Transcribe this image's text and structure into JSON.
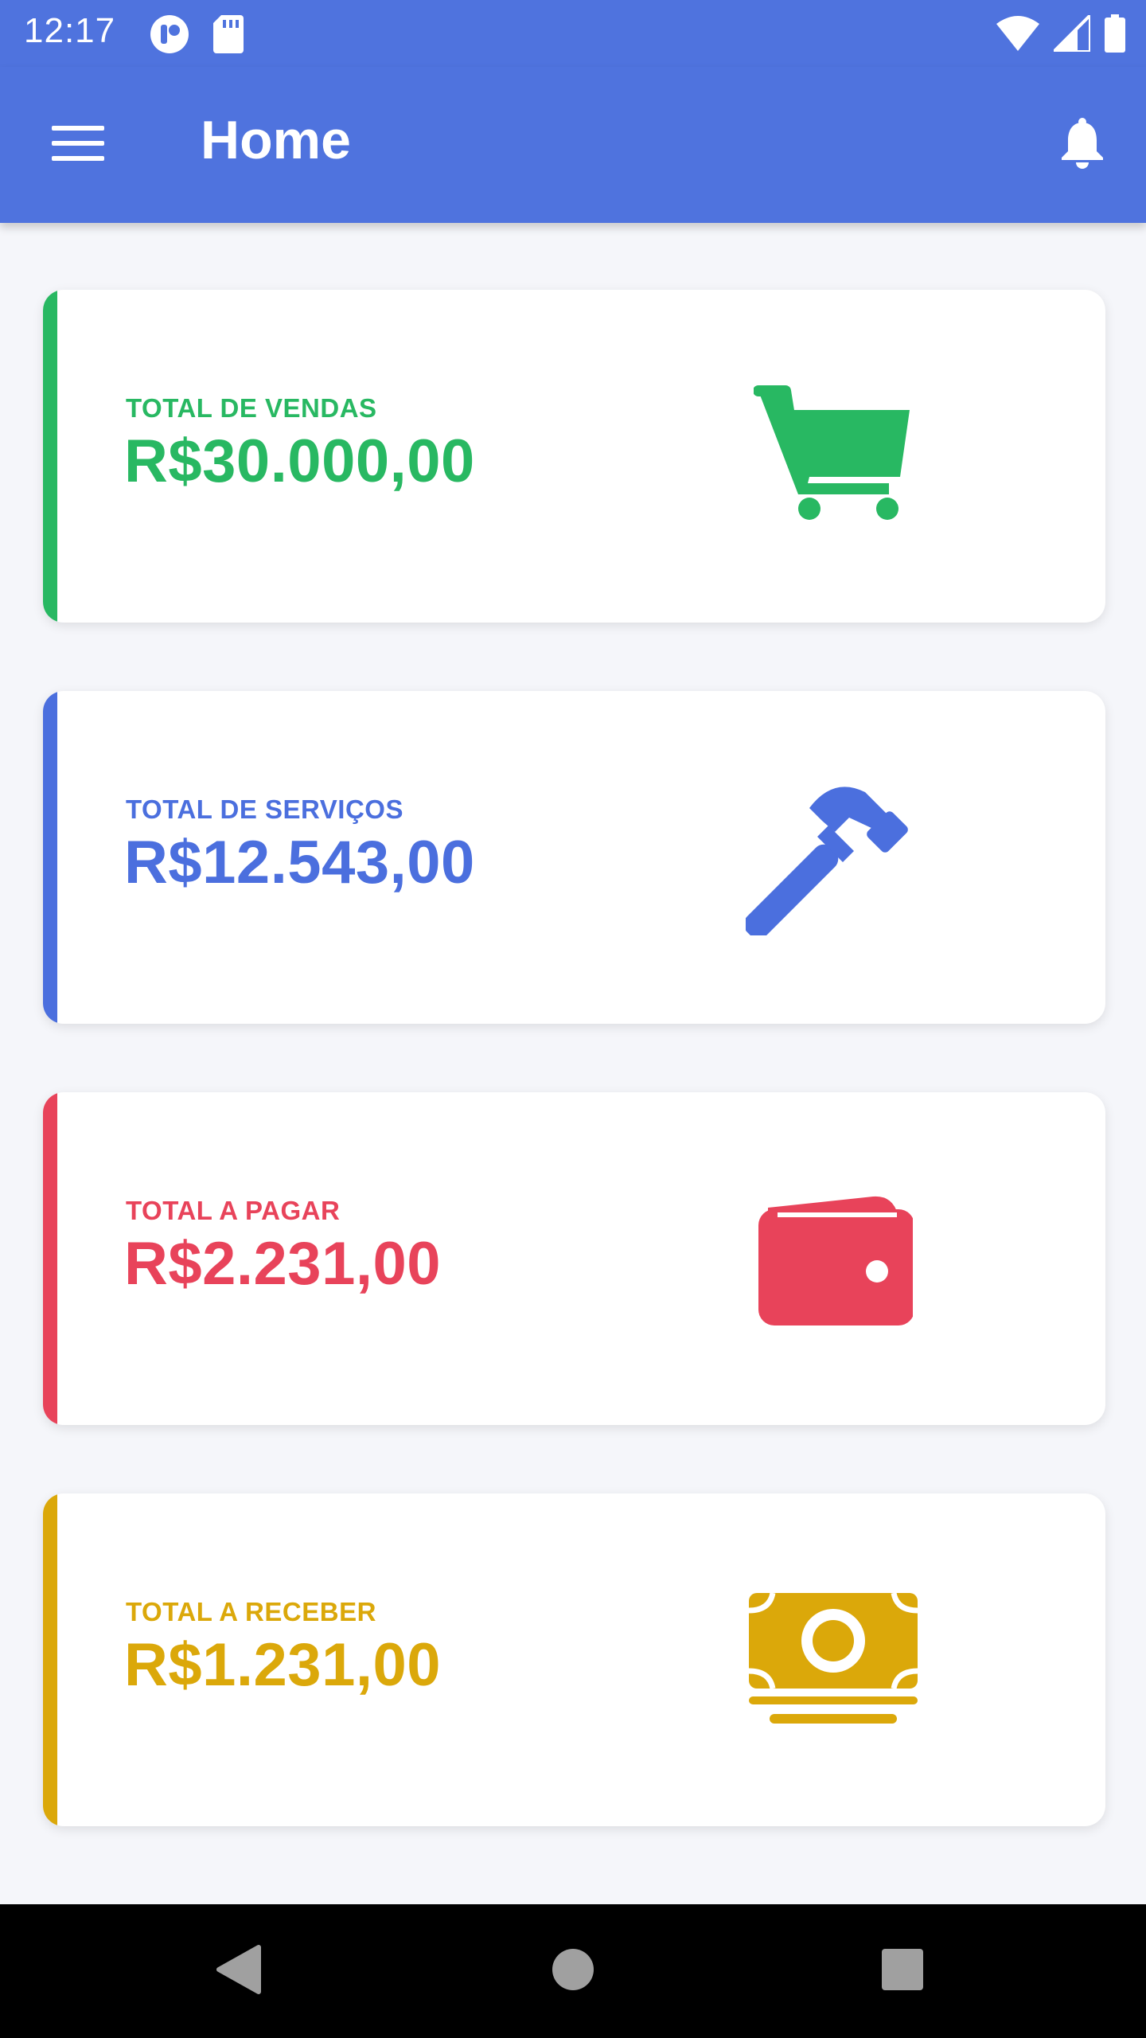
{
  "status_bar": {
    "time": "12:17",
    "icons": [
      "app-notification-icon",
      "sd-card-icon",
      "wifi-icon",
      "signal-icon",
      "battery-icon"
    ]
  },
  "app_bar": {
    "title": "Home",
    "menu_icon": "menu-icon",
    "bell_icon": "bell-icon"
  },
  "cards": [
    {
      "label": "TOTAL DE VENDAS",
      "value": "R$30.000,00",
      "color": "#28b862",
      "icon": "shopping-cart-icon"
    },
    {
      "label": "TOTAL DE SERVIÇOS",
      "value": "R$12.543,00",
      "color": "#4b6fde",
      "icon": "hammer-icon"
    },
    {
      "label": "TOTAL A PAGAR",
      "value": "R$2.231,00",
      "color": "#e8435a",
      "icon": "wallet-icon"
    },
    {
      "label": "TOTAL A RECEBER",
      "value": "R$1.231,00",
      "color": "#dba80a",
      "icon": "money-bill-icon"
    }
  ],
  "nav_bar": {
    "icons": [
      "back-icon",
      "home-icon",
      "recents-icon"
    ]
  }
}
